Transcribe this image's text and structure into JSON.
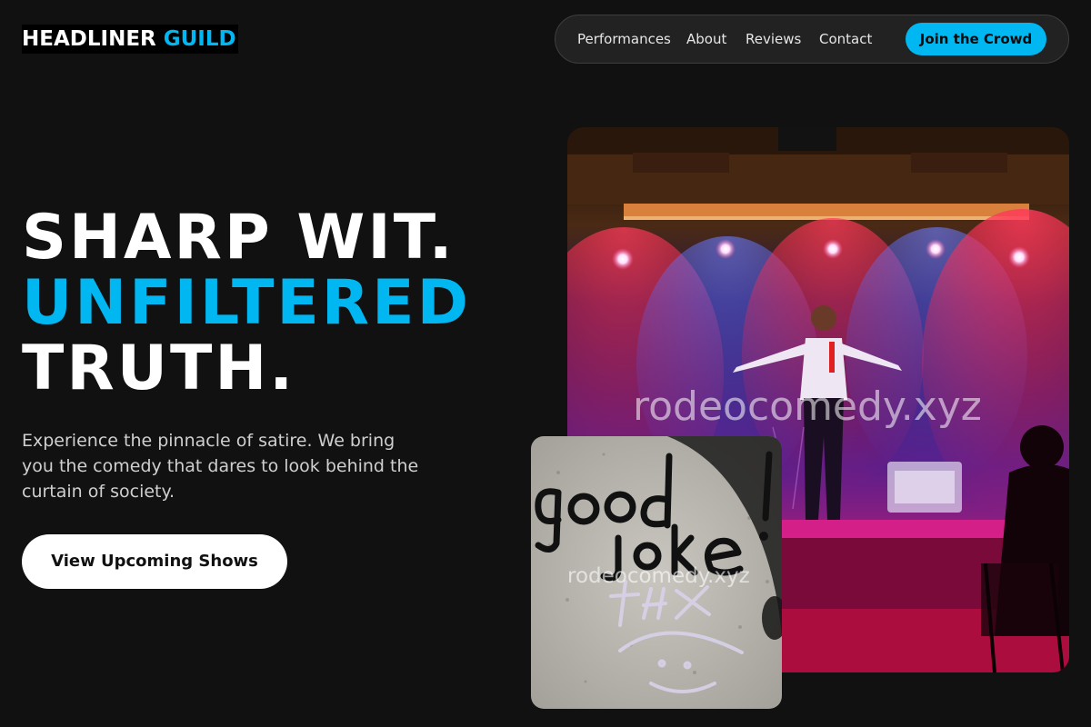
{
  "brand": {
    "name_primary": "HEADLINER",
    "name_accent": "GUILD",
    "accent_color": "#00b7f1"
  },
  "nav": {
    "links": [
      "Performances",
      "About",
      "Reviews",
      "Contact"
    ],
    "cta_label": "Join the Crowd"
  },
  "hero": {
    "title_line_1": "SHARP WIT.",
    "title_line_2": "UNFILTERED",
    "title_line_3": "TRUTH.",
    "subtitle": "Experience the pinnacle of satire. We bring you the comedy that dares to look behind the curtain of society.",
    "cta_label": "View Upcoming Shows"
  },
  "images": {
    "stage_photo": {
      "subject": "comedian performing on stage under red and blue spotlights",
      "watermark": "rodeocomedy.xyz"
    },
    "graffiti_photo": {
      "subject": "graffiti on a concrete wall",
      "graffiti_text": "good joke!",
      "watermark": "rodeocomedy.xyz"
    }
  }
}
